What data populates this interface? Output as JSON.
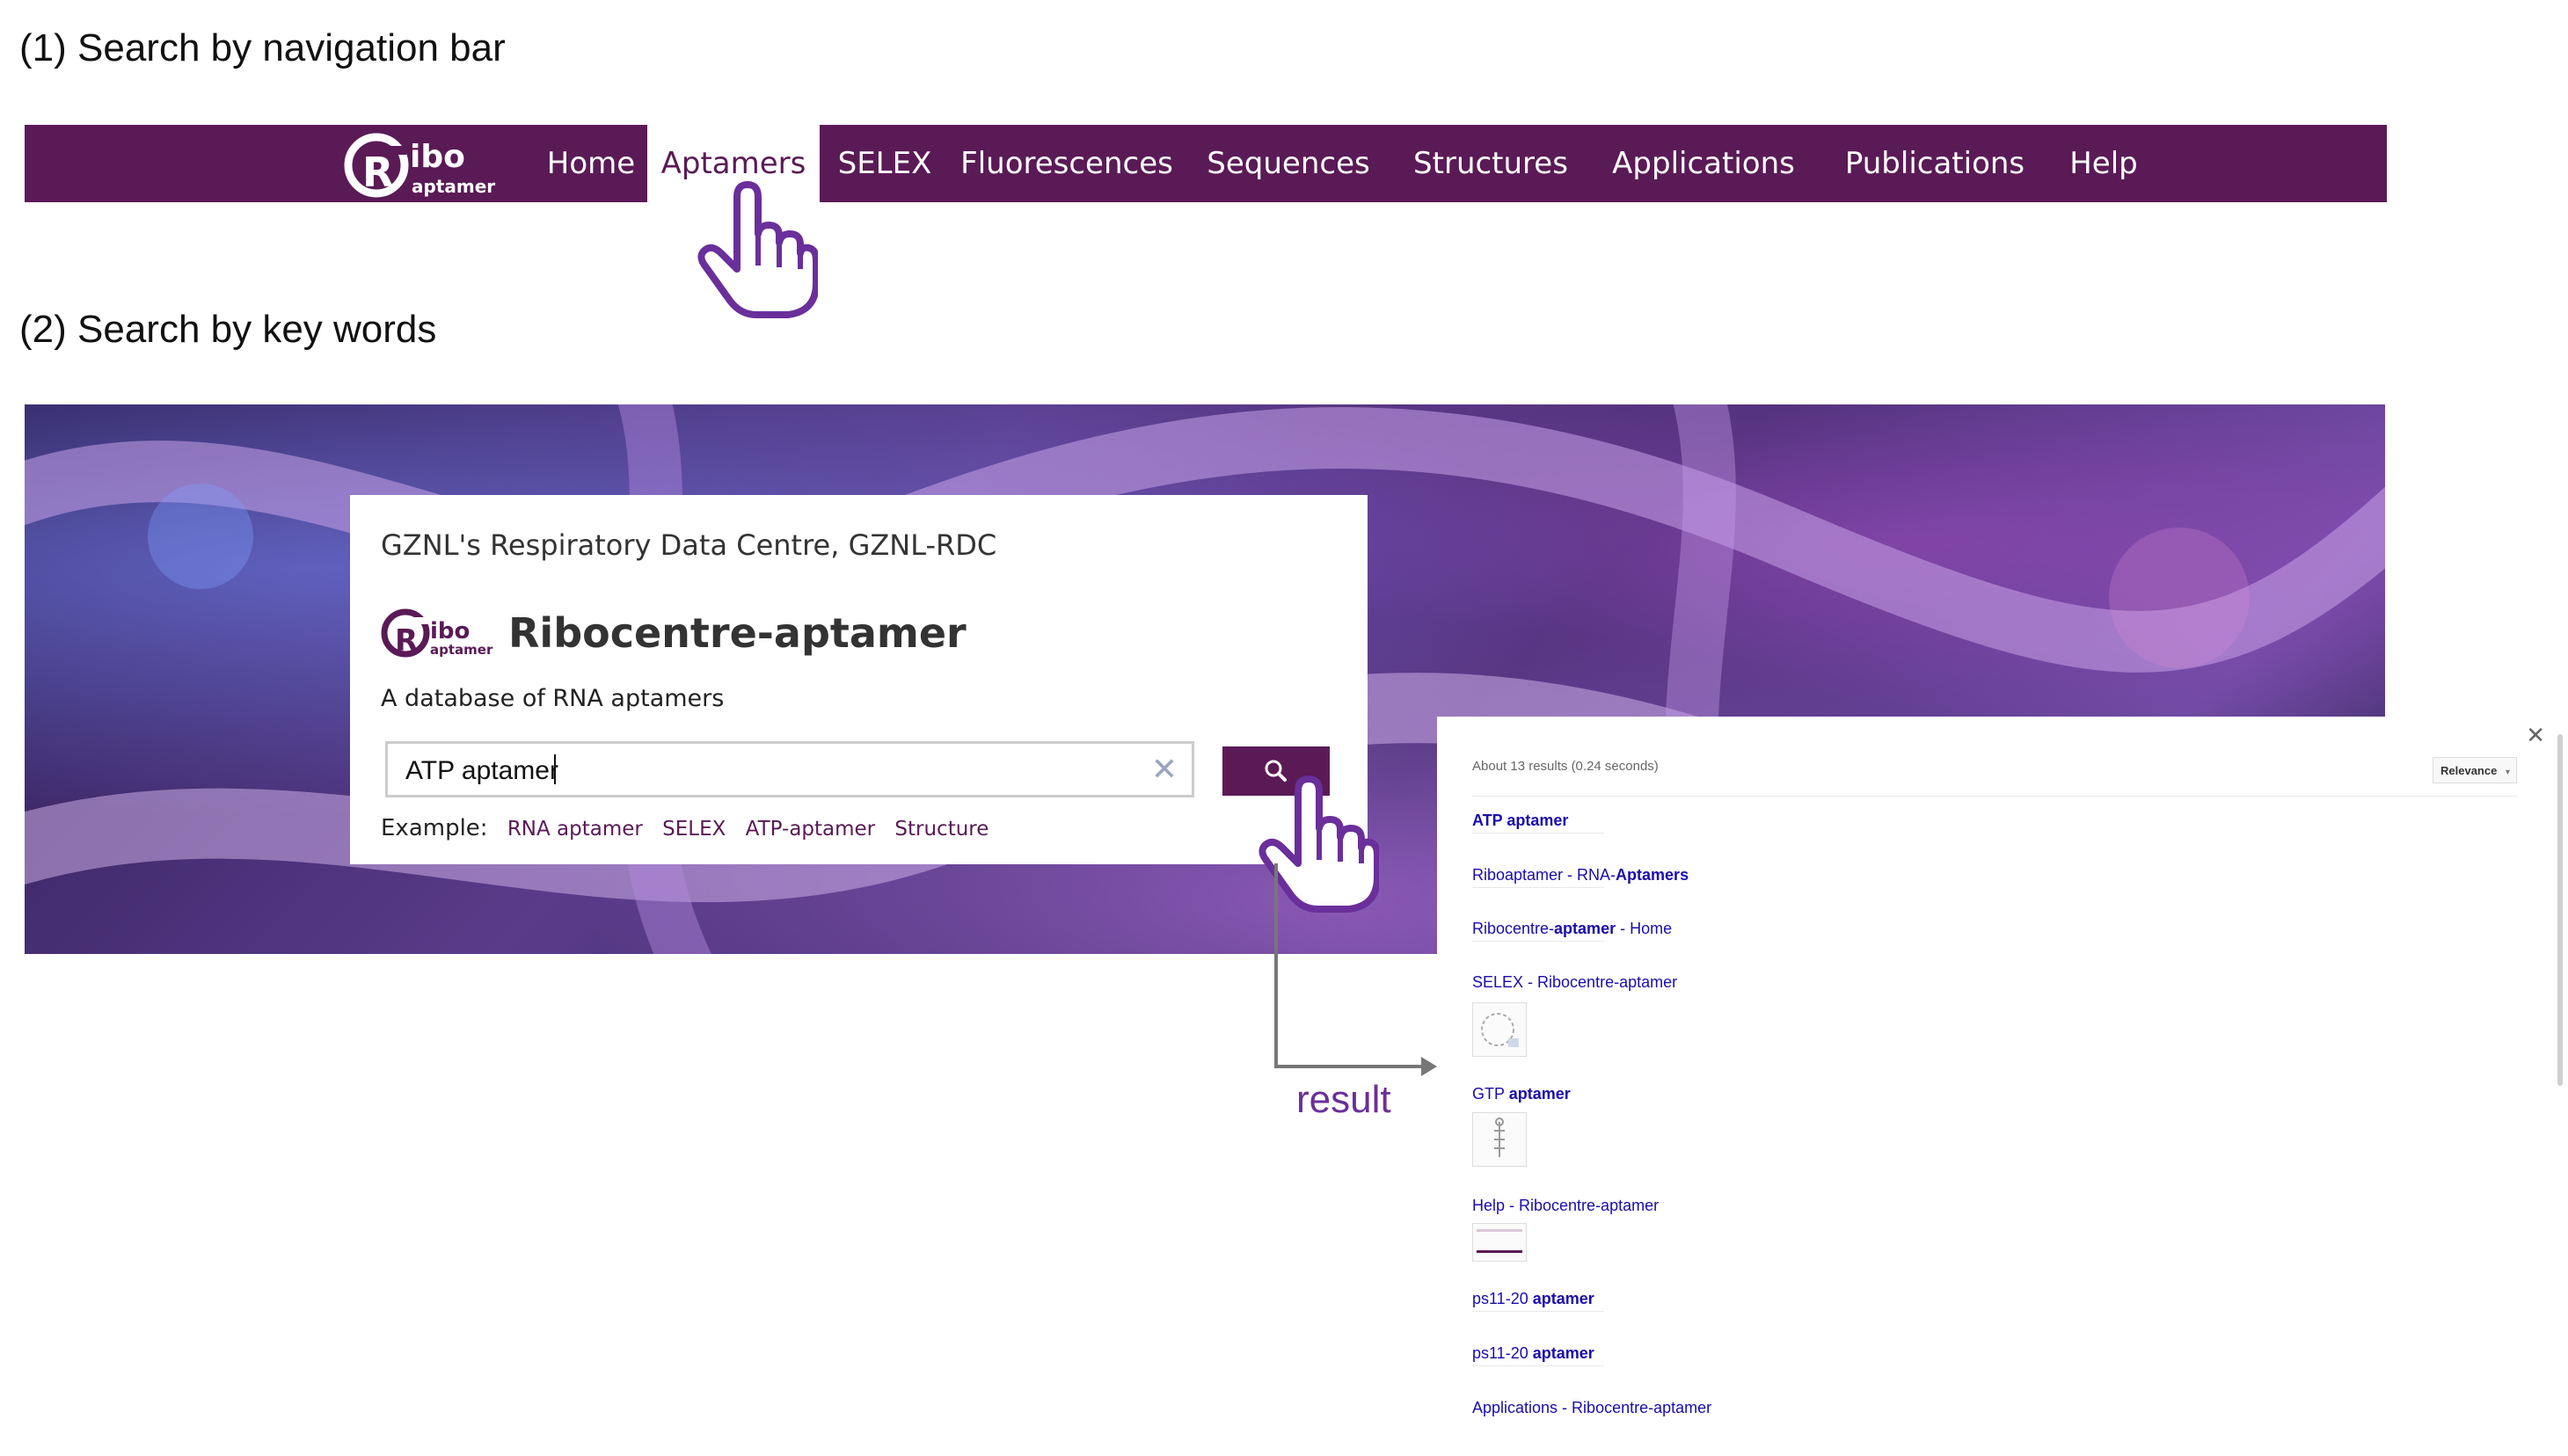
{
  "sections": {
    "nav_title": "(1) Search by navigation bar",
    "keyword_title": "(2) Search by key words"
  },
  "navbar": {
    "brand_main": "ibo",
    "brand_sub": "aptamer",
    "items": [
      {
        "label": "Home"
      },
      {
        "label": "Aptamers"
      },
      {
        "label": "SELEX"
      },
      {
        "label": "Fluorescences"
      },
      {
        "label": "Sequences"
      },
      {
        "label": "Structures"
      },
      {
        "label": "Applications"
      },
      {
        "label": "Publications"
      },
      {
        "label": "Help"
      }
    ],
    "active": "Aptamers"
  },
  "search_card": {
    "org": "GZNL's Respiratory Data Centre, GZNL-RDC",
    "title": "Ribocentre-aptamer",
    "tagline": "A database of RNA aptamers",
    "query": "ATP aptamer",
    "examples_label": "Example:",
    "examples": [
      "RNA aptamer",
      "SELEX",
      "ATP-aptamer",
      "Structure"
    ]
  },
  "result_label": "result",
  "results": {
    "stats": "About 13 results (0.24 seconds)",
    "sort": "Relevance",
    "items": [
      {
        "pre": "",
        "bold": "ATP aptamer",
        "post": ""
      },
      {
        "pre": "Riboaptamer - RNA-",
        "bold": "Aptamers",
        "post": ""
      },
      {
        "pre": "Ribocentre-",
        "bold": "aptamer",
        "post": " - Home"
      },
      {
        "pre": "SELEX - Ribocentre-aptamer",
        "bold": "",
        "post": ""
      },
      {
        "pre": "GTP ",
        "bold": "aptamer",
        "post": ""
      },
      {
        "pre": "Help - Ribocentre-aptamer",
        "bold": "",
        "post": ""
      },
      {
        "pre": "ps11-20 ",
        "bold": "aptamer",
        "post": ""
      },
      {
        "pre": "ps11-20 ",
        "bold": "aptamer",
        "post": ""
      },
      {
        "pre": "Applications - Ribocentre-aptamer",
        "bold": "",
        "post": ""
      }
    ]
  },
  "colors": {
    "brand": "#5a1a56",
    "link": "#1a0dab",
    "pointer": "#6a2f9a"
  }
}
